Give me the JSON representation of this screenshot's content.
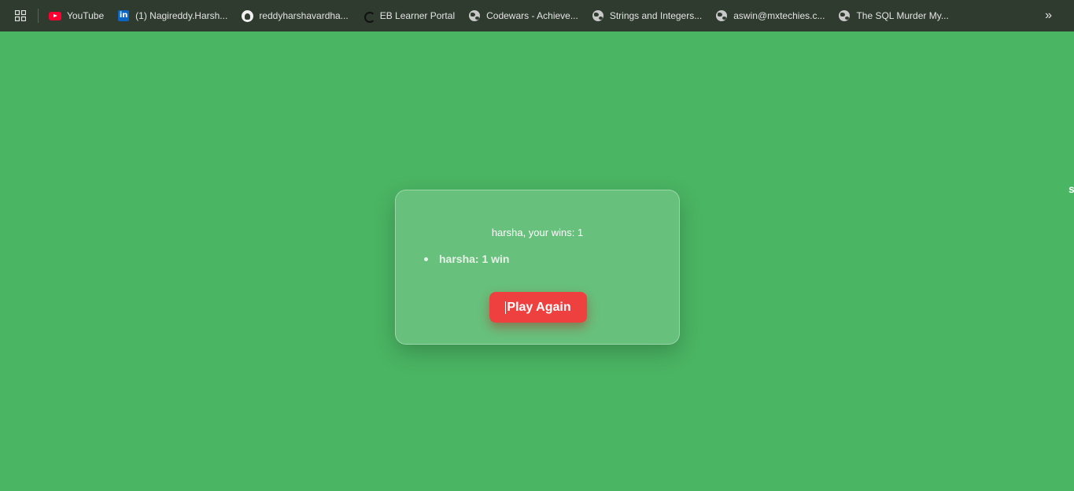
{
  "bookmarks": [
    {
      "label": "YouTube",
      "icon": "youtube-icon"
    },
    {
      "label": "(1) Nagireddy.Harsh...",
      "icon": "linkedin-icon"
    },
    {
      "label": "reddyharshavardha...",
      "icon": "github-icon"
    },
    {
      "label": "EB Learner Portal",
      "icon": "eb-icon"
    },
    {
      "label": "Codewars - Achieve...",
      "icon": "globe-icon"
    },
    {
      "label": "Strings and Integers...",
      "icon": "globe-icon"
    },
    {
      "label": "aswin@mxtechies.c...",
      "icon": "globe-icon"
    },
    {
      "label": "The SQL Murder My...",
      "icon": "globe-icon"
    }
  ],
  "overflow_label": "»",
  "card": {
    "wins_text": "harsha, your wins: 1",
    "leaderboard": [
      {
        "entry": "harsha: 1 win"
      }
    ],
    "play_again_label": "Play Again"
  },
  "edge_char": "s",
  "colors": {
    "background": "#4ab563",
    "bookmarks_bar": "#2f3b2f",
    "button": "#ef4040"
  }
}
